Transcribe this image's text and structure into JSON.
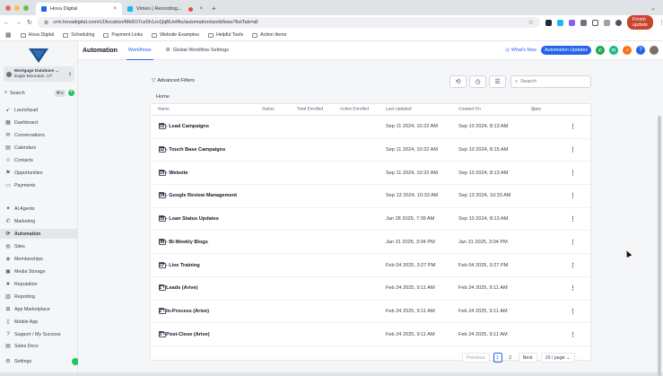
{
  "browser": {
    "tabs": [
      {
        "title": "Hova Digital",
        "favicon_color": "#2563eb"
      },
      {
        "title": "Vimeo | Recording...",
        "favicon_color": "#1ab7ea"
      }
    ],
    "url": "crm.hovadigital.com/v2/location/Mk6O7ce5h1zvQqBUefAo/automation/workflows?listTab=all",
    "finish_update": "Finish update",
    "bookmarks": [
      "Hova Digital",
      "Scheduling",
      "Payment Links",
      "Website Examples",
      "Helpful Tools",
      "Action Items"
    ]
  },
  "sidebar": {
    "account_name": "Mortgage Database ...",
    "account_location": "Eagle Mountain, UT",
    "search_label": "Search",
    "search_kbd": "⌘ K",
    "items": [
      {
        "label": "Launchpad",
        "icon": "rocket-icon"
      },
      {
        "label": "Dashboard",
        "icon": "dashboard-icon"
      },
      {
        "label": "Conversations",
        "icon": "chat-icon"
      },
      {
        "label": "Calendars",
        "icon": "calendar-icon"
      },
      {
        "label": "Contacts",
        "icon": "contacts-icon"
      },
      {
        "label": "Opportunities",
        "icon": "funnel-icon"
      },
      {
        "label": "Payments",
        "icon": "card-icon"
      },
      {
        "label": "AI Agents",
        "icon": "sparkle-icon"
      },
      {
        "label": "Marketing",
        "icon": "megaphone-icon"
      },
      {
        "label": "Automation",
        "icon": "automation-icon"
      },
      {
        "label": "Sites",
        "icon": "globe-icon"
      },
      {
        "label": "Memberships",
        "icon": "membership-icon"
      },
      {
        "label": "Media Storage",
        "icon": "media-icon"
      },
      {
        "label": "Reputation",
        "icon": "star-icon"
      },
      {
        "label": "Reporting",
        "icon": "chart-icon"
      },
      {
        "label": "App Marketplace",
        "icon": "apps-icon"
      },
      {
        "label": "Mobile App",
        "icon": "phone-icon"
      },
      {
        "label": "Support / My Success",
        "icon": "support-icon"
      },
      {
        "label": "Sales Docs",
        "icon": "doc-icon"
      },
      {
        "label": "Settings",
        "icon": "gear-icon"
      }
    ]
  },
  "header": {
    "title": "Automation",
    "tab_workflows": "Workflows",
    "tab_global": "Global Workflow Settings",
    "whats_new": "What's New",
    "automation_updates": "Automation Updates"
  },
  "toolbar": {
    "advanced_filters": "Advanced Filters",
    "search_placeholder": "Search",
    "breadcrumb": "Home"
  },
  "table": {
    "columns": [
      "Name",
      "Status",
      "Total Enrolled",
      "Active Enrolled",
      "Last Updated",
      "Created On",
      "Stats"
    ],
    "rows": [
      {
        "name": "01 - Lead Campaigns",
        "updated": "Sep 11 2024, 10:22 AM",
        "created": "Sep 10 2024, 8:13 AM"
      },
      {
        "name": "02 - Touch Base Campaigns",
        "updated": "Sep 11 2024, 10:22 AM",
        "created": "Sep 10 2024, 8:15 AM"
      },
      {
        "name": "03 - Website",
        "updated": "Sep 11 2024, 10:22 AM",
        "created": "Sep 10 2024, 8:13 AM"
      },
      {
        "name": "04 - Google Review Management",
        "updated": "Sep 13 2024, 10:33 AM",
        "created": "Sep 13 2024, 10:33 AM"
      },
      {
        "name": "05 - Loan Status Updates",
        "updated": "Jan 28 2025, 7:39 AM",
        "created": "Sep 10 2024, 8:13 AM"
      },
      {
        "name": "06 - Bi-Weekly Blogs",
        "updated": "Jan 31 2025, 3:04 PM",
        "created": "Jan 31 2025, 3:04 PM"
      },
      {
        "name": "07 - Live Training",
        "updated": "Feb 04 2025, 3:27 PM",
        "created": "Feb 04 2025, 3:27 PM"
      },
      {
        "name": "1 - Leads (Arive)",
        "updated": "Feb 24 2025, 9:11 AM",
        "created": "Feb 24 2025, 9:11 AM"
      },
      {
        "name": "2 - In-Process (Arive)",
        "updated": "Feb 24 2025, 9:11 AM",
        "created": "Feb 24 2025, 9:11 AM"
      },
      {
        "name": "3 - Post-Close (Arive)",
        "updated": "Feb 24 2025, 9:11 AM",
        "created": "Feb 24 2025, 9:11 AM"
      }
    ]
  },
  "pagination": {
    "previous": "Previous",
    "pages": [
      "1",
      "2"
    ],
    "current": "1",
    "next": "Next",
    "per_page": "10 / page"
  }
}
